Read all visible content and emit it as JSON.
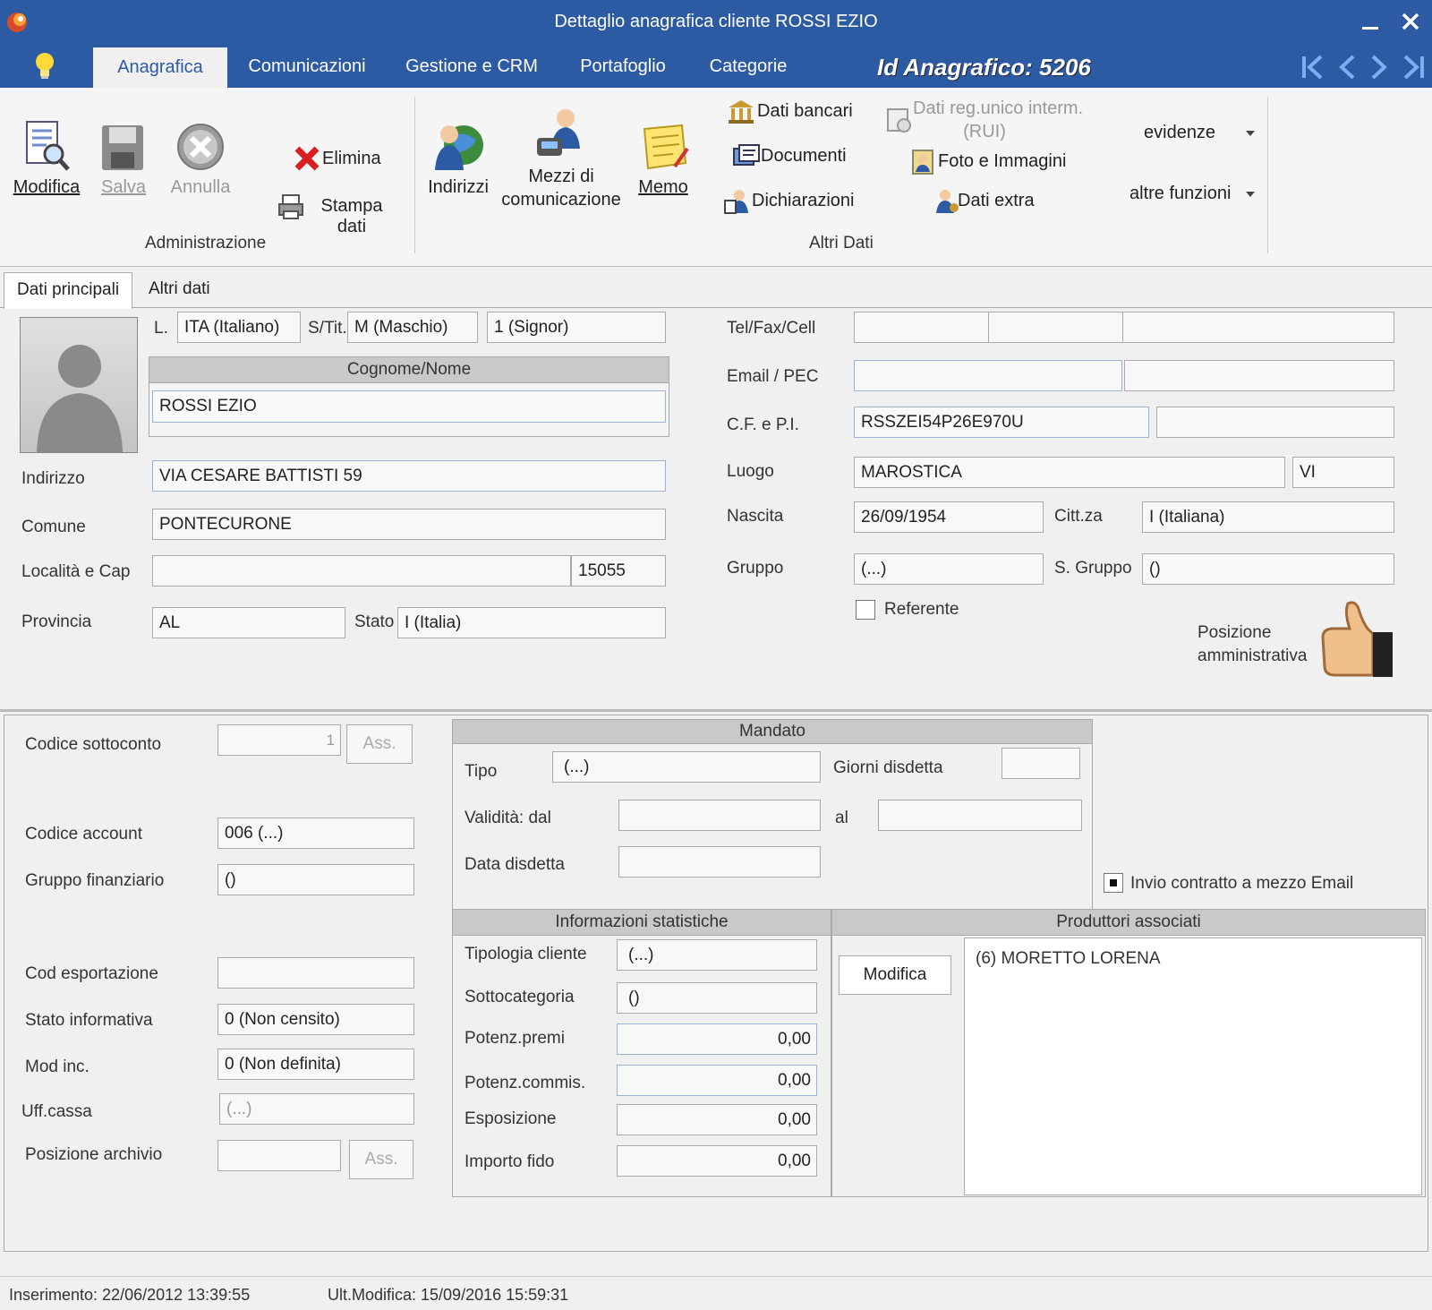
{
  "window": {
    "title": "Dettaglio anagrafica cliente ROSSI EZIO"
  },
  "tabs": [
    "Anagrafica",
    "Comunicazioni",
    "Gestione e CRM",
    "Portafoglio",
    "Categorie"
  ],
  "id_anagrafico": "Id Anagrafico: 5206",
  "ribbon": {
    "modifica": "Modifica",
    "salva": "Salva",
    "annulla": "Annulla",
    "elimina": "Elimina",
    "stampa_dati": "Stampa dati",
    "group_amministrazione": "Administrazione",
    "indirizzi": "Indirizzi",
    "mezzi_1": "Mezzi di",
    "mezzi_2": "comunicazione",
    "memo": "Memo",
    "dati_bancari": "Dati bancari",
    "documenti": "Documenti",
    "dichiarazioni": "Dichiarazioni",
    "rui_1": "Dati reg.unico interm.",
    "rui_2": "(RUI)",
    "foto": "Foto e Immagini",
    "dati_extra": "Dati extra",
    "evidenze": "evidenze",
    "altre_funzioni": "altre funzioni",
    "group_altri_dati": "Altri Dati"
  },
  "subtabs": [
    "Dati principali",
    "Altri dati"
  ],
  "main": {
    "l_label": "L.",
    "lingua": "ITA (Italiano)",
    "stit_label": "S/Tit.",
    "sesso": "M (Maschio)",
    "titolo": "1 (Signor)",
    "cognome_nome_hdr": "Cognome/Nome",
    "cognome_nome": "ROSSI EZIO",
    "indirizzo_label": "Indirizzo",
    "indirizzo": "VIA CESARE BATTISTI 59",
    "comune_label": "Comune",
    "comune": "PONTECURONE",
    "localita_label": "Località e Cap",
    "localita": "",
    "cap": "15055",
    "provincia_label": "Provincia",
    "provincia": "AL",
    "stato_label": "Stato",
    "stato": "I (Italia)",
    "tel_label": "Tel/Fax/Cell",
    "email_label": "Email / PEC",
    "cf_label": "C.F. e P.I.",
    "cf": "RSSZEI54P26E970U",
    "luogo_label": "Luogo",
    "luogo": "MAROSTICA",
    "luogo_prov": "VI",
    "nascita_label": "Nascita",
    "nascita": "26/09/1954",
    "cittza_label": "Citt.za",
    "cittadinanza": "I (Italiana)",
    "gruppo_label": "Gruppo",
    "gruppo": "(...)",
    "sgruppo_label": "S. Gruppo",
    "sgruppo": "()",
    "referente_label": "Referente",
    "posizione_1": "Posizione",
    "posizione_2": "amministrativa"
  },
  "lower": {
    "codice_sottoconto_label": "Codice sottoconto",
    "codice_sottoconto": "1",
    "ass": "Ass.",
    "codice_account_label": "Codice account",
    "codice_account": "006 (...)",
    "gruppo_fin_label": "Gruppo finanziario",
    "gruppo_fin": "()",
    "cod_esport_label": "Cod esportazione",
    "cod_esport": "",
    "stato_info_label": "Stato informativa",
    "stato_info": "0 (Non censito)",
    "mod_inc_label": "Mod inc.",
    "mod_inc": "0 (Non definita)",
    "uff_cassa_label": "Uff.cassa",
    "uff_cassa": "(...)",
    "pos_archivio_label": "Posizione archivio",
    "mandato_hdr": "Mandato",
    "tipo_label": "Tipo",
    "tipo": "(...)",
    "giorni_disdetta_label": "Giorni disdetta",
    "validita_label": "Validità: dal",
    "al_label": "al",
    "data_disdetta_label": "Data disdetta",
    "invio_label": "Invio contratto a mezzo Email",
    "info_stat_hdr": "Informazioni statistiche",
    "tipologia_label": "Tipologia cliente",
    "tipologia": "(...)",
    "sottocat_label": "Sottocategoria",
    "sottocat": "()",
    "pot_premi_label": "Potenz.premi",
    "pot_premi": "0,00",
    "pot_commis_label": "Potenz.commis.",
    "pot_commis": "0,00",
    "esposizione_label": "Esposizione",
    "esposizione": "0,00",
    "importo_fido_label": "Importo fido",
    "importo_fido": "0,00",
    "produttori_hdr": "Produttori associati",
    "modifica_btn": "Modifica",
    "produttori": [
      "(6) MORETTO LORENA"
    ]
  },
  "status": {
    "inserimento": "Inserimento: 22/06/2012 13:39:55",
    "ult_modifica": "Ult.Modifica: 15/09/2016 15:59:31"
  }
}
